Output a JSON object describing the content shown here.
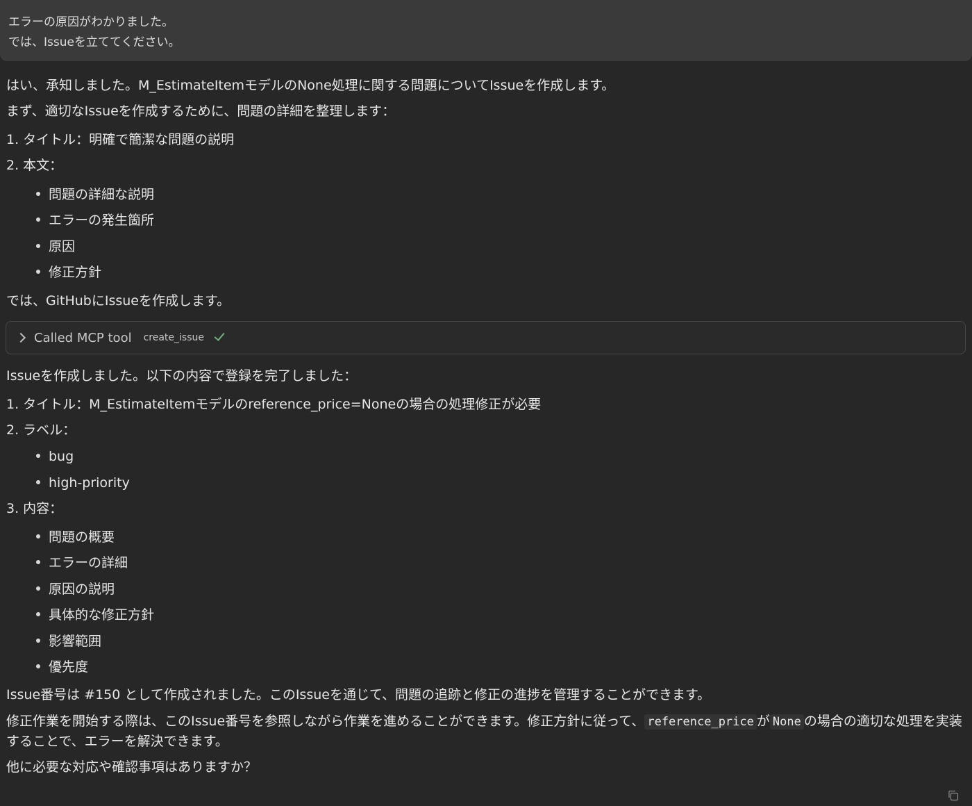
{
  "user_message": {
    "line1": "エラーの原因がわかりました。",
    "line2": "では、Issueを立ててください。"
  },
  "assistant": {
    "intro": "はい、承知しました。M_EstimateItemモデルのNone処理に関する問題についてIssueを作成します。",
    "organize": "まず、適切なIssueを作成するために、問題の詳細を整理します：",
    "plan_1": "1. タイトル：明確で簡潔な問題の説明",
    "plan_2": "2. 本文：",
    "plan_2_items": [
      "問題の詳細な説明",
      "エラーの発生箇所",
      "原因",
      "修正方針"
    ],
    "create_line": "では、GitHubにIssueを作成します。",
    "tool_call": {
      "label": "Called MCP tool",
      "tool_name": "create_issue",
      "status_icon": "check-icon",
      "status_color": "#6fb37c"
    },
    "created": "Issueを作成しました。以下の内容で登録を完了しました：",
    "result_1": "1. タイトル：M_EstimateItemモデルのreference_price=Noneの場合の処理修正が必要",
    "result_2": "2. ラベル：",
    "result_2_items": [
      "bug",
      "high-priority"
    ],
    "result_3": "3. 内容：",
    "result_3_items": [
      "問題の概要",
      "エラーの詳細",
      "原因の説明",
      "具体的な修正方針",
      "影響範囲",
      "優先度"
    ],
    "issue_number": "Issue番号は #150 として作成されました。このIssueを通じて、問題の追跡と修正の進捗を管理することができます。",
    "fix_part1": "修正作業を開始する際は、このIssue番号を参照しながら作業を進めることができます。修正方針に従って、",
    "fix_code1": "reference_price",
    "fix_part2": "が",
    "fix_code2": "None",
    "fix_part3": "の場合の適切な処理を実装",
    "fix_line2": "することで、エラーを解決できます。",
    "question": "他に必要な対応や確認事項はありますか？"
  },
  "icons": {
    "copy": "copy-icon"
  }
}
